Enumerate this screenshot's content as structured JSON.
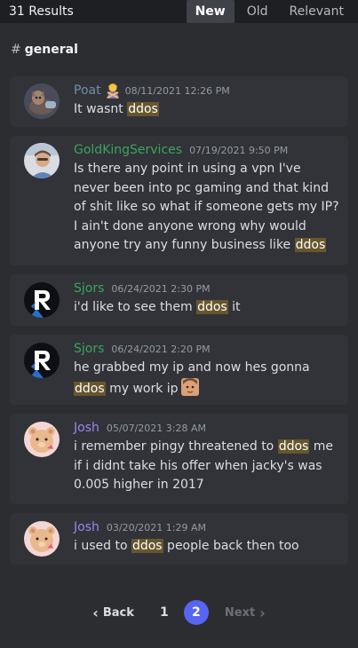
{
  "header": {
    "results": "31 Results",
    "sort_tabs": [
      "New",
      "Old",
      "Relevant"
    ]
  },
  "channel": {
    "hash": "#",
    "name": "general"
  },
  "highlight_color": "#67562d",
  "messages": [
    {
      "author": "Poat",
      "author_color": "#6d8fa6",
      "badge": "person-gesturing-no-emoji",
      "time": "08/11/2021 12:26 PM",
      "parts": [
        "It wasnt ",
        "ddos",
        ""
      ]
    },
    {
      "author": "GoldKingServices",
      "author_color": "#3ba55c",
      "time": "07/19/2021 9:50 PM",
      "parts": [
        "Is there any point in using a vpn I've never been into pc gaming and that kind of shit like so what if someone gets my IP? I ain't done anyone wrong why would anyone try any funny business like ",
        "ddos",
        ""
      ]
    },
    {
      "author": "Sjors",
      "author_color": "#3ba55c",
      "time": "06/24/2021 2:30 PM",
      "parts": [
        "i'd like to see them ",
        "ddos",
        " it"
      ]
    },
    {
      "author": "Sjors",
      "author_color": "#3ba55c",
      "time": "06/24/2021 2:20 PM",
      "parts": [
        "he grabbed my ip and now hes gonna ",
        "ddos",
        " my work ip"
      ],
      "trailing_emoji": "custom-face-emoji"
    },
    {
      "author": "Josh",
      "author_color": "#9b84ec",
      "time": "05/07/2021 3:28 AM",
      "parts": [
        "i remember pingy threatened to ",
        "ddos",
        " me if i didnt take his offer when jacky's was 0.005 higher in 2017"
      ]
    },
    {
      "author": "Josh",
      "author_color": "#9b84ec",
      "time": "03/20/2021 1:29 AM",
      "parts": [
        "i used to ",
        "ddos",
        " people back then too"
      ]
    }
  ],
  "pagination": {
    "back_label": "Back",
    "pages": [
      "1",
      "2"
    ],
    "current": "2",
    "next_label": "Next"
  }
}
